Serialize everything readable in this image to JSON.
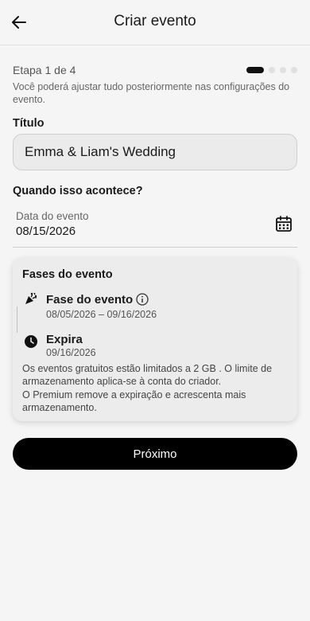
{
  "header": {
    "title": "Criar evento"
  },
  "step": {
    "text": "Etapa 1 de 4",
    "current": 1,
    "total": 4,
    "hint": "Você poderá ajustar tudo posteriormente nas configurações do evento."
  },
  "form": {
    "title_label": "Título",
    "title_value": "Emma & Liam's Wedding",
    "when_label": "Quando isso acontece?",
    "date_label": "Data do evento",
    "date_value": "08/15/2026"
  },
  "phases": {
    "title": "Fases do evento",
    "items": [
      {
        "name": "Fase do evento",
        "date": "08/05/2026 – 09/16/2026",
        "icon": "party-popper-icon"
      },
      {
        "name": "Expira",
        "date": "09/16/2026",
        "icon": "clock-icon"
      }
    ],
    "note1": "Os eventos gratuitos estão limitados a 2 GB . O limite de armazenamento aplica-se à conta do criador.",
    "note2": "O Premium remove a expiração e acrescenta mais armazenamento."
  },
  "actions": {
    "next_label": "Próximo"
  },
  "colors": {
    "primary": "#000000",
    "background": "#f5f5f5",
    "card": "#ececec"
  }
}
